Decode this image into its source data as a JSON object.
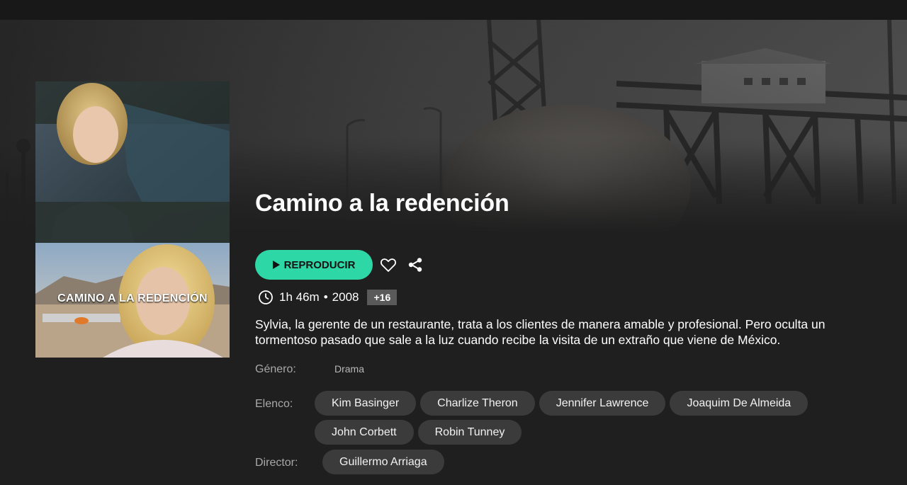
{
  "movie": {
    "title": "Camino a la redención",
    "poster_title": "CAMINO A LA REDENCIÓN",
    "duration": "1h 46m",
    "year": "2008",
    "separator": "•",
    "rating": "+16",
    "synopsis": "Sylvia, la gerente de un restaurante, trata a los clientes de manera amable y profesional. Pero oculta un tormentoso pasado que sale a la luz cuando recibe la visita de un extraño que viene de México."
  },
  "actions": {
    "play_label": "REPRODUCIR",
    "favorite_icon": "heart-icon",
    "share_icon": "share-icon"
  },
  "details": {
    "genre_label": "Género:",
    "genre_value": "Drama",
    "cast_label": "Elenco:",
    "cast": [
      "Kim Basinger",
      "Charlize Theron",
      "Jennifer Lawrence",
      "Joaquim De Almeida",
      "John Corbett",
      "Robin Tunney"
    ],
    "director_label": "Director:",
    "directors": [
      "Guillermo Arriaga"
    ]
  },
  "colors": {
    "accent": "#2dd8a6",
    "background": "#1f1f1f",
    "chip": "#3b3b3b",
    "badge": "#5a5a5a"
  }
}
